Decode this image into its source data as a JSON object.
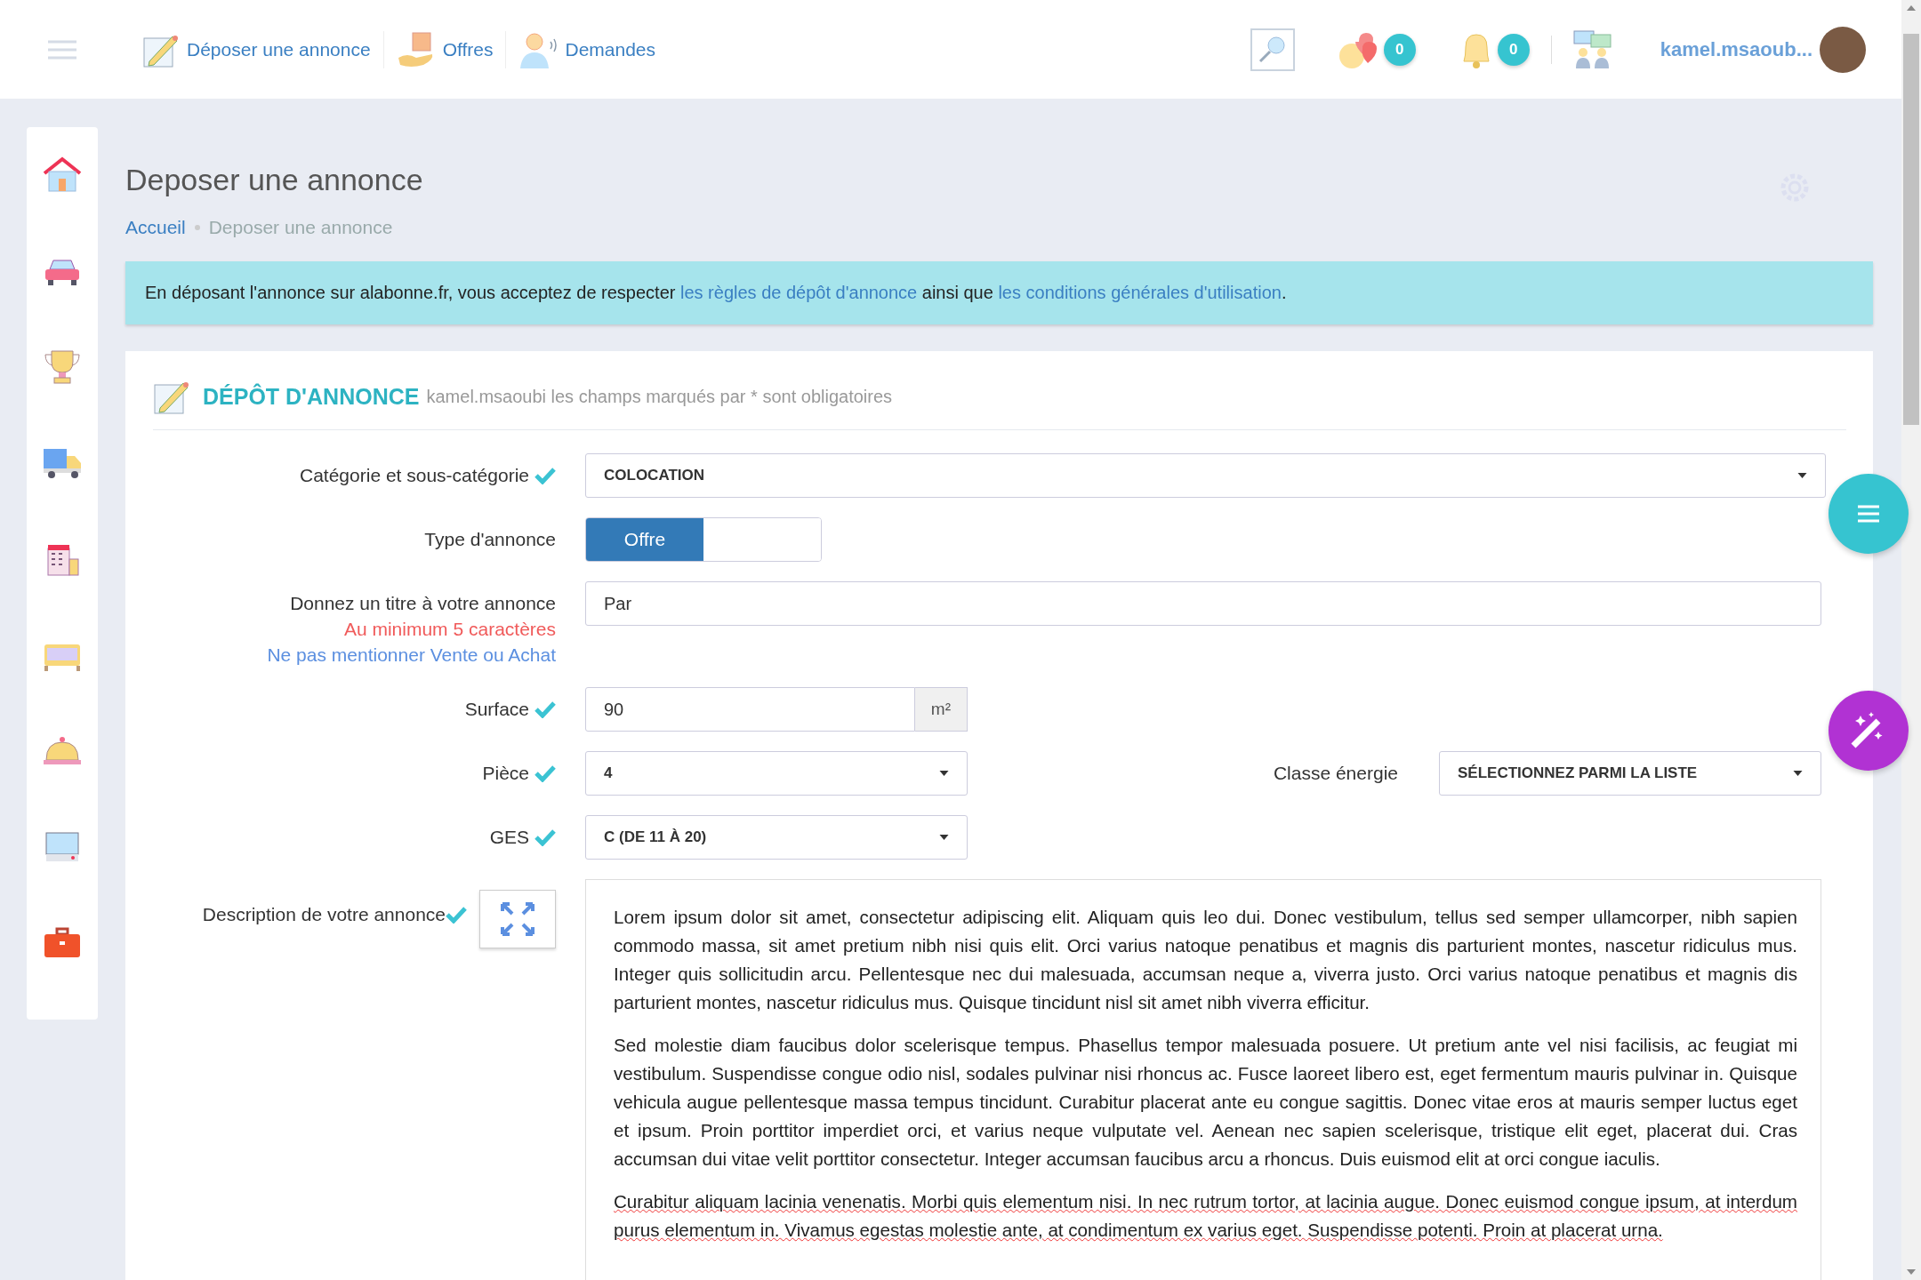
{
  "topbar": {
    "nav": [
      {
        "label": "Déposer une annonce"
      },
      {
        "label": "Offres"
      },
      {
        "label": "Demandes"
      }
    ],
    "favorites_count": "0",
    "notifications_count": "0",
    "username": "kamel.msaoub..."
  },
  "page": {
    "title": "Deposer une annonce",
    "breadcrumb": [
      {
        "label": "Accueil",
        "link": true
      },
      {
        "label": "Deposer une annonce",
        "link": false
      }
    ]
  },
  "alert": {
    "text_before": "En déposant l'annonce sur alabonne.fr, vous acceptez de respecter ",
    "link1": "les règles de dépôt d'annonce",
    "text_middle": " ainsi que ",
    "link2": "les conditions générales d'utilisation",
    "text_after": "."
  },
  "form": {
    "title": "DÉPÔT D'ANNONCE",
    "subtitle": "kamel.msaoubi les champs marqués par * sont obligatoires",
    "fields": [
      {
        "kind": "wide-select",
        "label": "Catégorie et sous-catégorie",
        "valid": true,
        "value": "COLOCATION"
      },
      {
        "kind": "toggle",
        "label": "Type d'annonce",
        "value": "Offre",
        "on": true
      },
      {
        "kind": "text",
        "label": "Donnez un titre à votre annonce",
        "value": "Par",
        "hints": [
          {
            "text": "Au minimum 5 caractères",
            "kind": "error"
          },
          {
            "text": "Ne pas mentionner Vente ou Achat",
            "kind": "info"
          }
        ]
      },
      {
        "kind": "unit",
        "label": "Surface",
        "valid": true,
        "value": "90",
        "unit": "m²"
      },
      {
        "kind": "select",
        "label": "Pièce",
        "valid": true,
        "value": "4",
        "side": {
          "label": "Classe énergie",
          "value": "SÉLECTIONNEZ PARMI LA LISTE"
        }
      },
      {
        "kind": "select",
        "label": "GES",
        "valid": true,
        "value": "C (DE 11 À 20)"
      }
    ],
    "description": {
      "label": "Description de votre annonce",
      "valid": true,
      "paragraphs": [
        {
          "text": "Lorem ipsum dolor sit amet, consectetur adipiscing elit. Aliquam quis leo dui. Donec vestibulum, tellus sed semper ullamcorper, nibh sapien commodo massa, sit amet pretium nibh nisi quis elit. Orci varius natoque penatibus et magnis dis parturient montes, nascetur ridiculus mus. Integer quis sollicitudin arcu. Pellentesque nec dui malesuada, accumsan neque a, viverra justo. Orci varius natoque penatibus et magnis dis parturient montes, nascetur ridiculus mus. Quisque tincidunt nisl sit amet nibh viverra efficitur.",
          "spellcheck": false
        },
        {
          "text": "Sed molestie diam faucibus dolor scelerisque tempus. Phasellus tempor malesuada posuere. Ut pretium ante vel nisi facilisis, ac feugiat mi vestibulum. Suspendisse congue odio nisl, sodales pulvinar nisi rhoncus ac. Fusce laoreet libero est, eget fermentum mauris pulvinar in. Quisque vehicula augue pellentesque massa tempus tincidunt. Curabitur placerat ante eu congue sagittis. Donec vitae eros at mauris semper luctus eget et ipsum. Proin porttitor imperdiet orci, et varius neque vulputate vel. Aenean nec sapien scelerisque, tristique elit eget, placerat dui. Cras accumsan dui vitae velit porttitor consectetur. Integer accumsan faucibus arcu a rhoncus. Duis euismod elit at orci congue iaculis.",
          "spellcheck": false
        },
        {
          "text": "Curabitur aliquam lacinia venenatis. Morbi quis elementum nisi. In nec rutrum tortor, at lacinia augue. Donec euismod congue ipsum, at interdum purus elementum in. Vivamus egestas molestie ante, at condimentum ex varius eget. Suspendisse potenti. Proin at placerat urna.",
          "spellcheck": true
        }
      ]
    }
  }
}
